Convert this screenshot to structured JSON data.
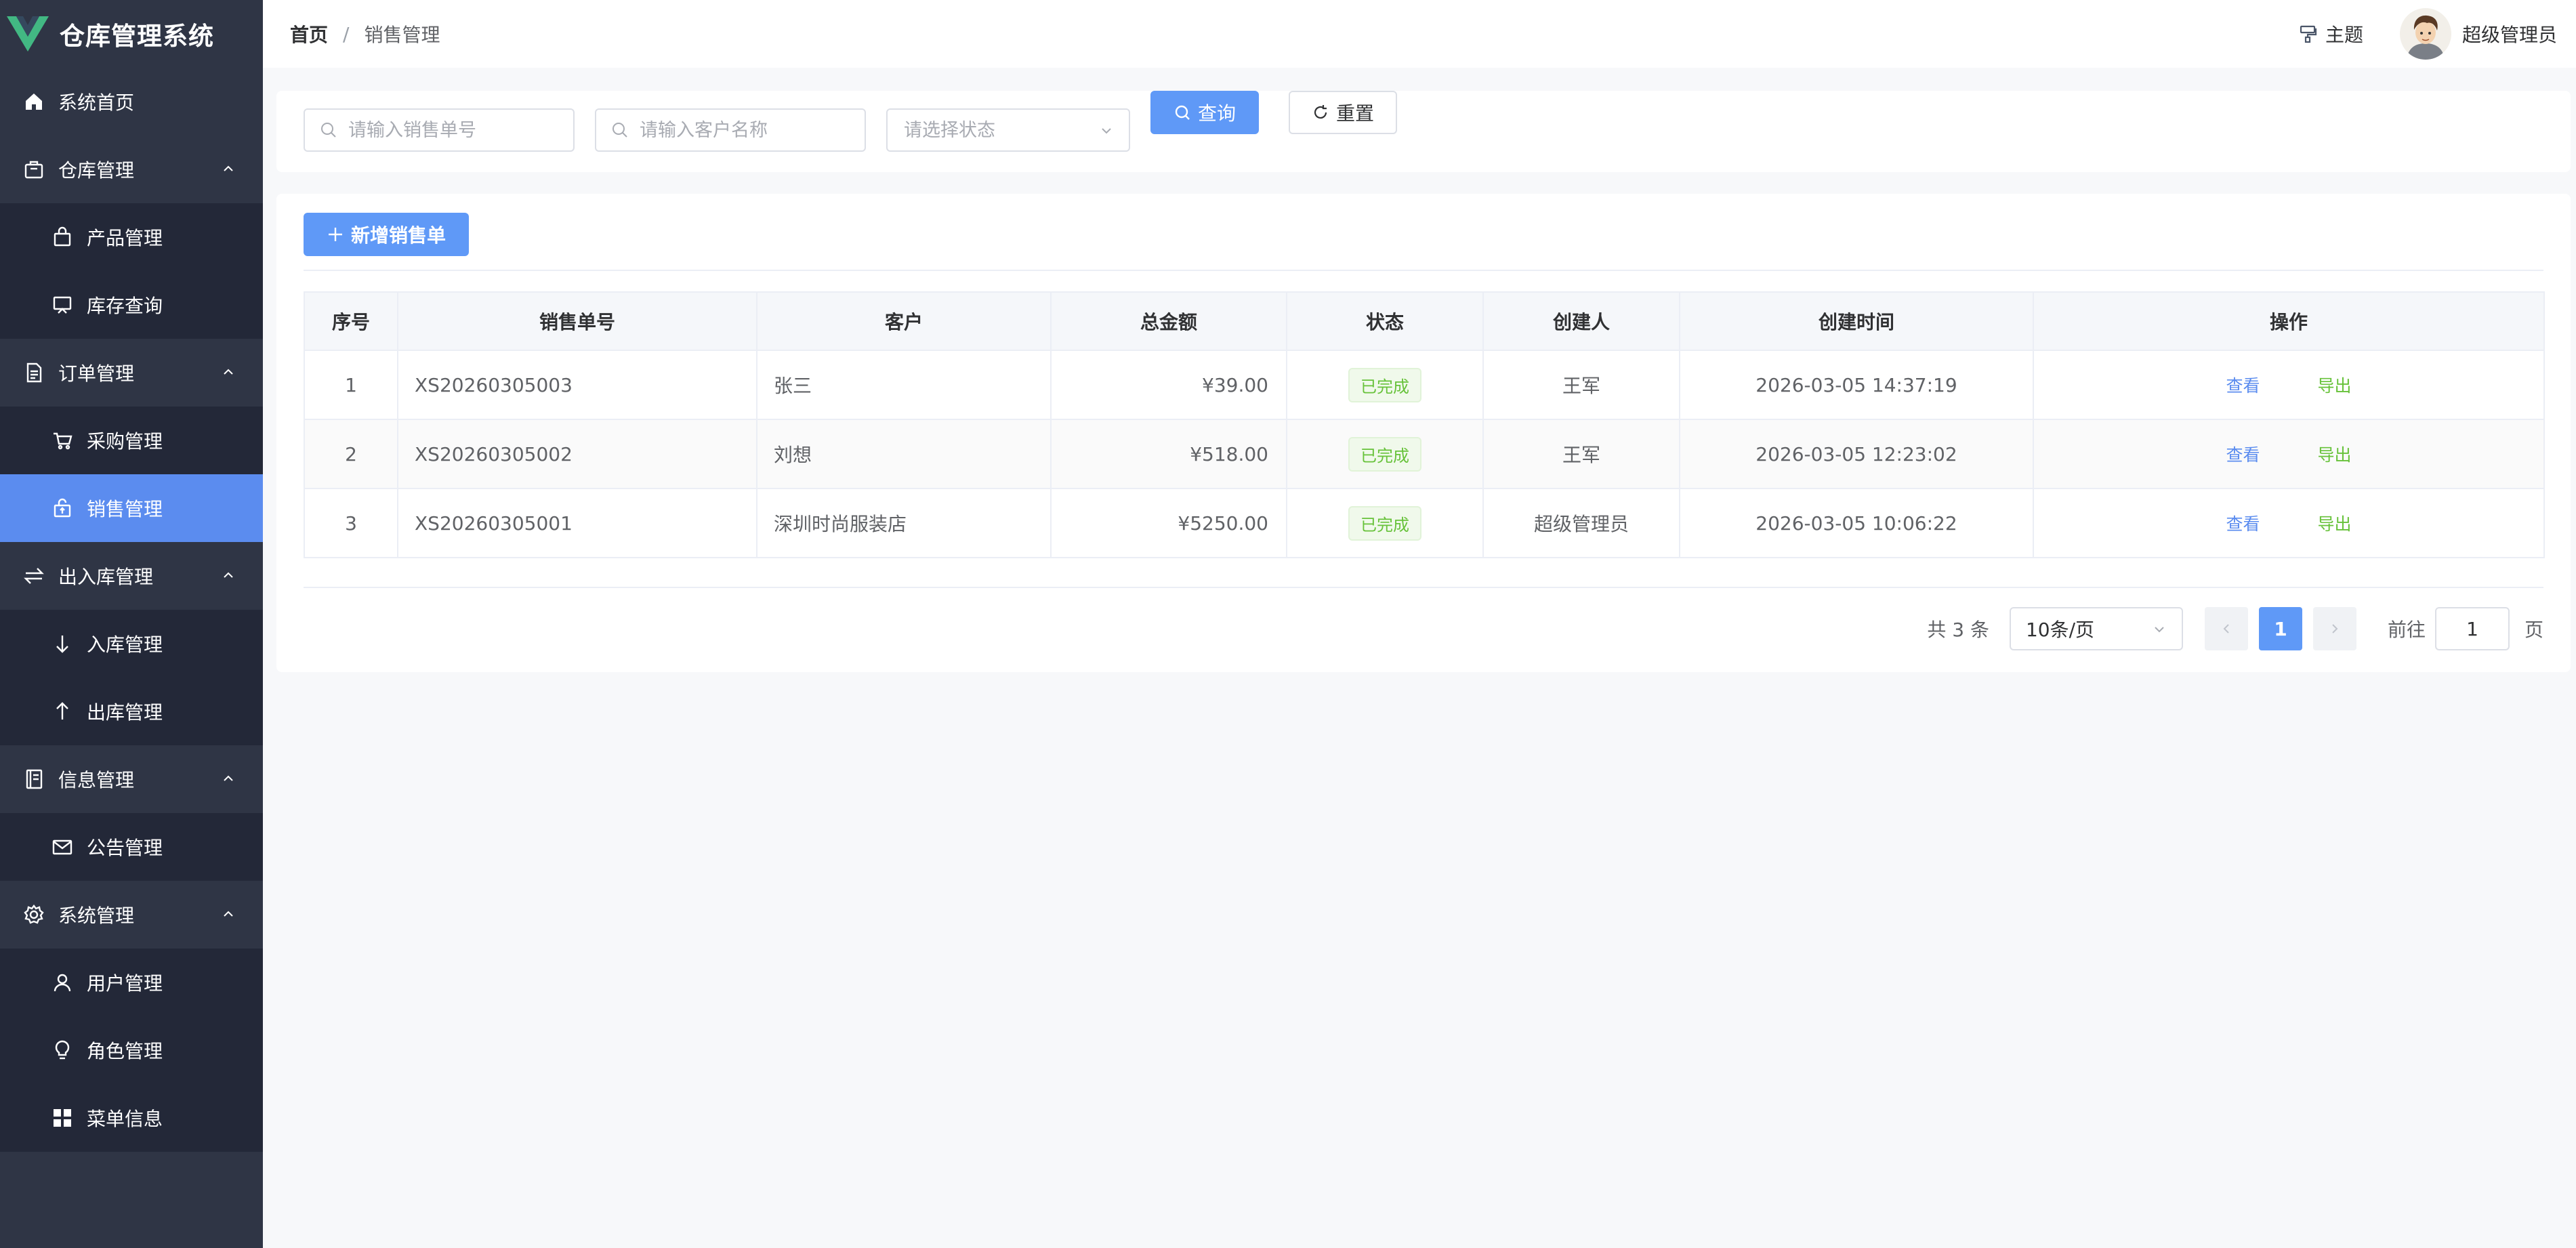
{
  "app": {
    "title": "仓库管理系统",
    "brand_color": "#42b883"
  },
  "sidebar": {
    "items": [
      {
        "label": "系统首页",
        "icon": "home-icon",
        "level": "top"
      },
      {
        "label": "仓库管理",
        "icon": "box-icon",
        "level": "top",
        "expanded": true
      },
      {
        "label": "产品管理",
        "icon": "bag-icon",
        "level": "sub"
      },
      {
        "label": "库存查询",
        "icon": "monitor-icon",
        "level": "sub"
      },
      {
        "label": "订单管理",
        "icon": "document-icon",
        "level": "top",
        "expanded": true
      },
      {
        "label": "采购管理",
        "icon": "cart-icon",
        "level": "sub"
      },
      {
        "label": "销售管理",
        "icon": "sell-icon",
        "level": "sub",
        "active": true
      },
      {
        "label": "出入库管理",
        "icon": "switch-icon",
        "level": "top",
        "expanded": true
      },
      {
        "label": "入库管理",
        "icon": "arrow-down-icon",
        "level": "sub"
      },
      {
        "label": "出库管理",
        "icon": "arrow-up-icon",
        "level": "sub"
      },
      {
        "label": "信息管理",
        "icon": "notebook-icon",
        "level": "top",
        "expanded": true
      },
      {
        "label": "公告管理",
        "icon": "message-icon",
        "level": "sub"
      },
      {
        "label": "系统管理",
        "icon": "gear-icon",
        "level": "top",
        "expanded": true
      },
      {
        "label": "用户管理",
        "icon": "user-icon",
        "level": "sub"
      },
      {
        "label": "角色管理",
        "icon": "bulb-icon",
        "level": "sub"
      },
      {
        "label": "菜单信息",
        "icon": "grid-icon",
        "level": "sub"
      }
    ]
  },
  "header": {
    "breadcrumb_home": "首页",
    "breadcrumb_sep": "/",
    "breadcrumb_current": "销售管理",
    "theme_label": "主题",
    "username": "超级管理员"
  },
  "search": {
    "order_placeholder": "请输入销售单号",
    "customer_placeholder": "请输入客户名称",
    "status_placeholder": "请选择状态",
    "query_label": "查询",
    "reset_label": "重置"
  },
  "toolbar": {
    "add_label": "新增销售单"
  },
  "table": {
    "columns": [
      "序号",
      "销售单号",
      "客户",
      "总金额",
      "状态",
      "创建人",
      "创建时间",
      "操作"
    ],
    "rows": [
      {
        "index": "1",
        "order_no": "XS20260305003",
        "customer": "张三",
        "amount": "¥39.00",
        "status": "已完成",
        "creator": "王军",
        "created_at": "2026-03-05 14:37:19",
        "view": "查看",
        "export": "导出"
      },
      {
        "index": "2",
        "order_no": "XS20260305002",
        "customer": "刘想",
        "amount": "¥518.00",
        "status": "已完成",
        "creator": "王军",
        "created_at": "2026-03-05 12:23:02",
        "view": "查看",
        "export": "导出"
      },
      {
        "index": "3",
        "order_no": "XS20260305001",
        "customer": "深圳时尚服装店",
        "amount": "¥5250.00",
        "status": "已完成",
        "creator": "超级管理员",
        "created_at": "2026-03-05 10:06:22",
        "view": "查看",
        "export": "导出"
      }
    ]
  },
  "pagination": {
    "total_text": "共 3 条",
    "page_size": "10条/页",
    "current_page": "1",
    "goto_label": "前往",
    "goto_value": "1",
    "page_suffix": "页"
  },
  "colors": {
    "sidebar_bg": "#2f3545",
    "sidebar_sub_bg": "#232838",
    "active_bg": "#5b8cef",
    "primary": "#5f99f7",
    "success": "#67c23a"
  }
}
